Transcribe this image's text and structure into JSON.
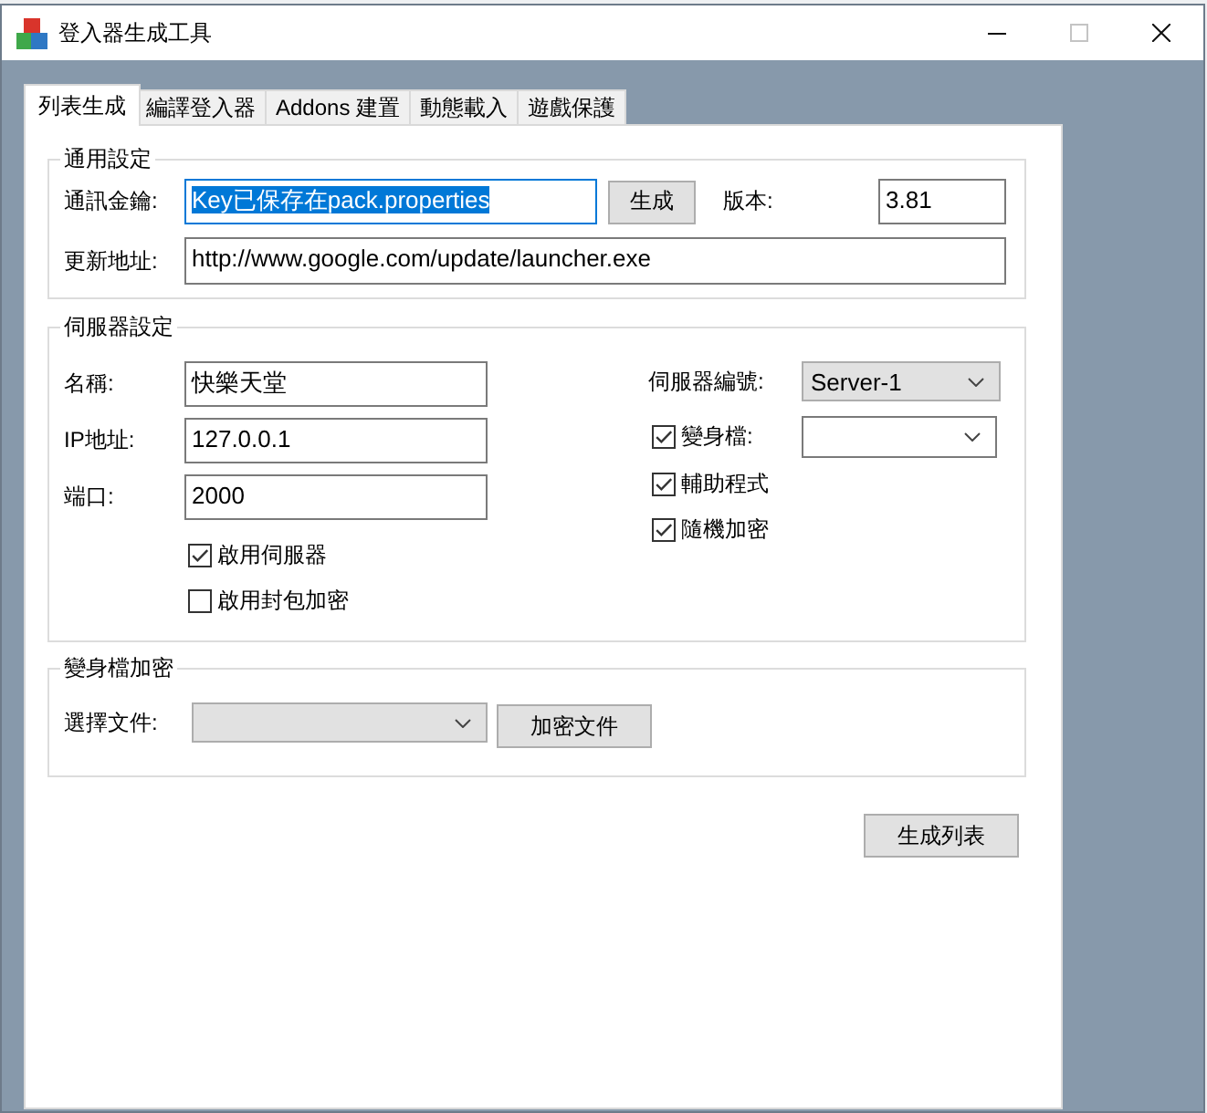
{
  "window": {
    "title": "登入器生成工具",
    "controls": [
      {
        "kind": "minimize",
        "disabled": false
      },
      {
        "kind": "maximize",
        "disabled": true
      },
      {
        "kind": "close",
        "disabled": false
      }
    ]
  },
  "tabs": [
    {
      "label": "列表生成",
      "selected": true
    },
    {
      "label": "編譯登入器",
      "selected": false
    },
    {
      "label": "Addons 建置",
      "selected": false
    },
    {
      "label": "動態載入",
      "selected": false
    },
    {
      "label": "遊戲保護",
      "selected": false
    }
  ],
  "general": {
    "title": "通用設定",
    "key_field": {
      "label": "通訊金鑰:",
      "value": "Key已保存在pack.properties",
      "focused": true
    },
    "generate_button": "生成",
    "version_field": {
      "label": "版本:",
      "value": "3.81"
    },
    "update_url_field": {
      "label": "更新地址:",
      "value": "http://www.google.com/update/launcher.exe"
    }
  },
  "server": {
    "title": "伺服器設定",
    "fields": [
      {
        "label": "名稱:",
        "value": "快樂天堂"
      },
      {
        "label": "IP地址:",
        "value": "127.0.0.1"
      },
      {
        "label": "端口:",
        "value": "2000"
      }
    ],
    "options": [
      {
        "label": "啟用伺服器",
        "checked": true
      },
      {
        "label": "啟用封包加密",
        "checked": false
      }
    ],
    "server_number": {
      "label": "伺服器編號:",
      "value": "Server-1",
      "editable": false
    },
    "features": [
      {
        "kind": "dropdown",
        "label": "變身檔:",
        "checked": true,
        "dropdown": {
          "editable": true
        }
      },
      {
        "kind": "plain",
        "label": "輔助程式",
        "checked": true
      },
      {
        "kind": "plain",
        "label": "隨機加密",
        "checked": true
      }
    ]
  },
  "encryption": {
    "title": "變身檔加密",
    "file_select": {
      "label": "選擇文件:",
      "editable": false
    },
    "encrypt_button": "加密文件"
  },
  "generate_list_button": "生成列表"
}
